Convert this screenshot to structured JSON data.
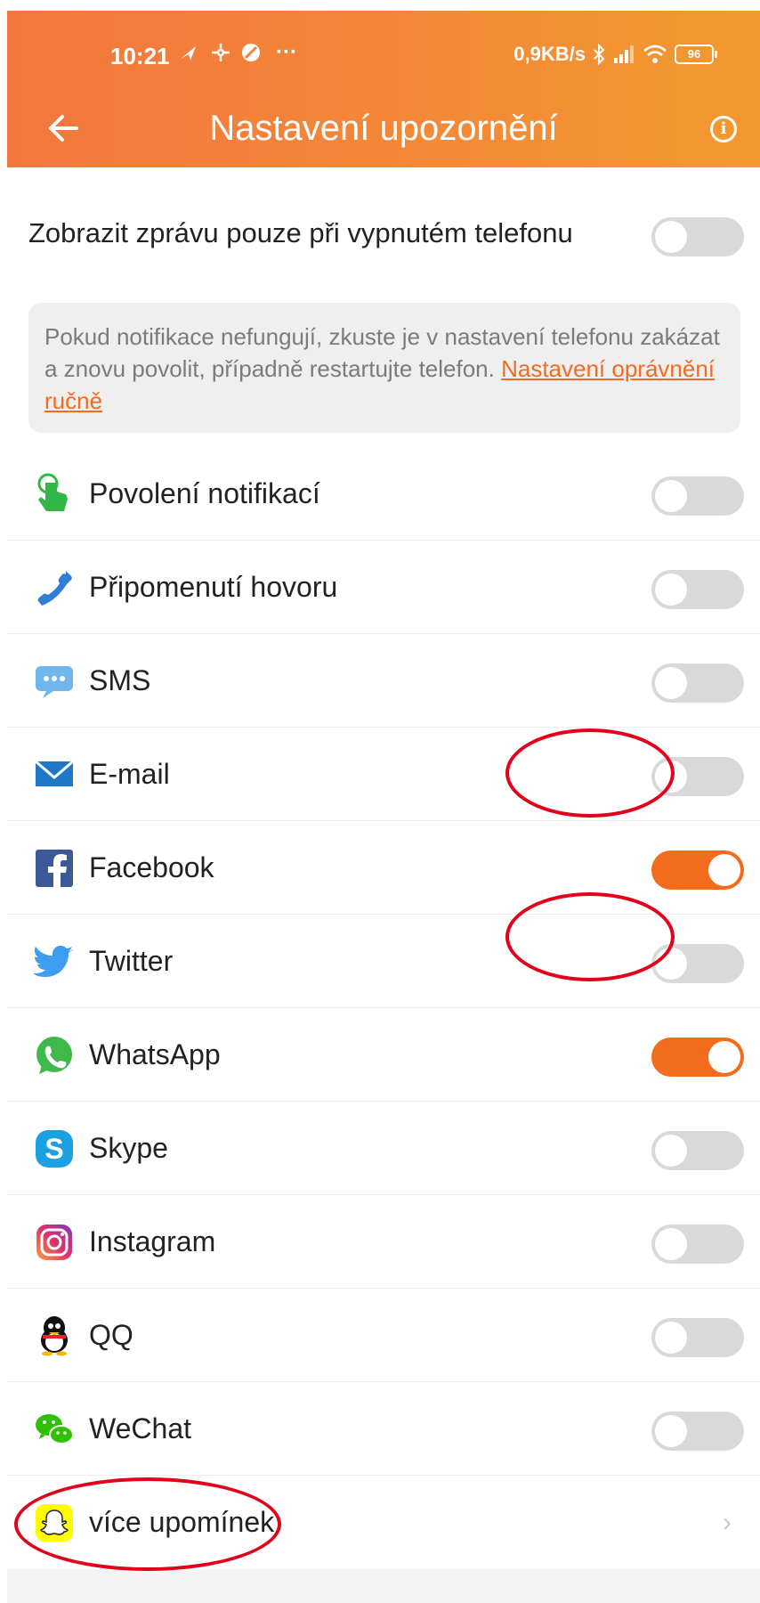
{
  "status_bar": {
    "time": "10:21",
    "notification_icons": [
      "navigation-icon",
      "fan-icon",
      "blocked-icon",
      "more-icon"
    ],
    "more_dots": "···",
    "net_speed": "0,9KB/s",
    "battery": "96"
  },
  "header": {
    "title": "Nastavení upozornění",
    "back_icon": "arrow-left-icon",
    "info_icon": "info-icon",
    "info_glyph": "i"
  },
  "screen_off": {
    "label": "Zobrazit zprávu pouze při vypnutém telefonu",
    "enabled": false
  },
  "tip": {
    "text": "Pokud notifikace nefungují, zkuste je v nastavení telefonu zakázat a znovu povolit, případně restartujte telefon. ",
    "link": "Nastavení oprávnění ručně"
  },
  "items": [
    {
      "label": "Povolení notifikací",
      "icon": "hand-tap-icon",
      "enabled": false
    },
    {
      "label": "Připomenutí hovoru",
      "icon": "phone-icon",
      "enabled": false
    },
    {
      "label": "SMS",
      "icon": "sms-icon",
      "enabled": false
    },
    {
      "label": "E-mail",
      "icon": "email-icon",
      "enabled": false
    },
    {
      "label": "Facebook",
      "icon": "facebook-icon",
      "enabled": true
    },
    {
      "label": "Twitter",
      "icon": "twitter-icon",
      "enabled": false
    },
    {
      "label": "WhatsApp",
      "icon": "whatsapp-icon",
      "enabled": true
    },
    {
      "label": "Skype",
      "icon": "skype-icon",
      "enabled": false
    },
    {
      "label": "Instagram",
      "icon": "instagram-icon",
      "enabled": false
    },
    {
      "label": "QQ",
      "icon": "qq-icon",
      "enabled": false
    },
    {
      "label": "WeChat",
      "icon": "wechat-icon",
      "enabled": false
    }
  ],
  "more": {
    "label": "více upomínek",
    "icon": "snapchat-icon",
    "chevron": "›"
  },
  "colors": {
    "header_start": "#f2773e",
    "header_end": "#f29a2e",
    "accent": "#f36b1c",
    "toggle_off": "#d9d9d9",
    "annotation": "#e3001b"
  }
}
